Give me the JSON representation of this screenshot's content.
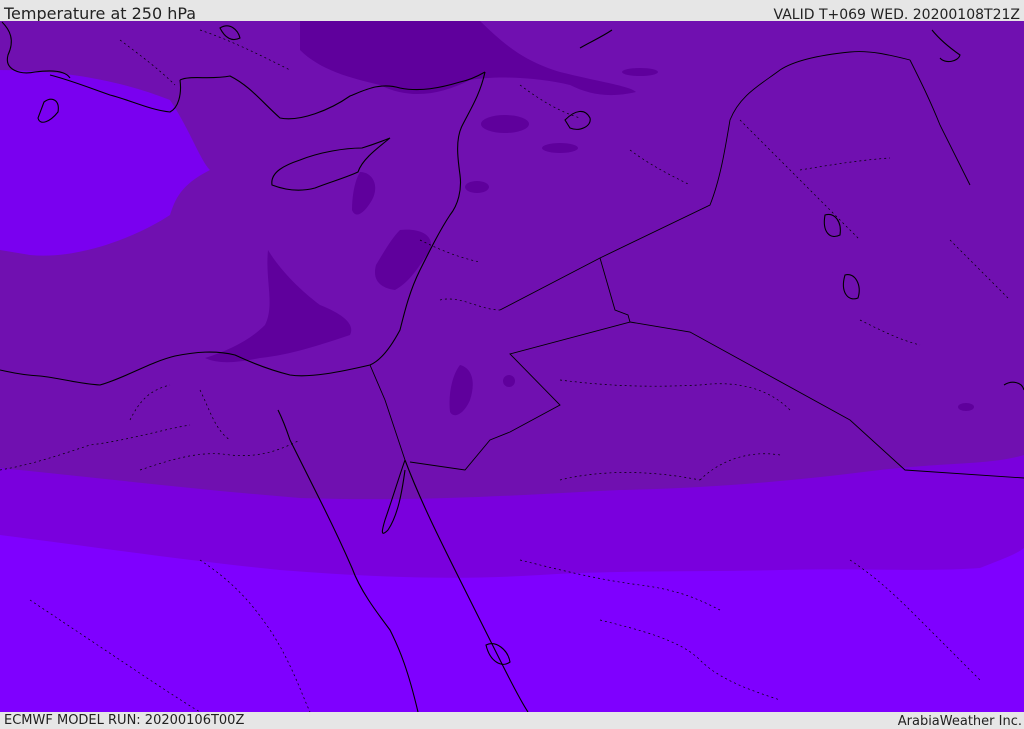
{
  "header": {
    "title": "Temperature at 250 hPa",
    "valid_time": "VALID T+069 WED. 20200108T21Z"
  },
  "footer": {
    "model_run": "ECMWF MODEL RUN: 20200106T00Z",
    "credit": "ArabiaWeather Inc."
  },
  "map": {
    "field": "Temperature at 250 hPa",
    "colors": {
      "coldest": "#5f009c",
      "cold": "#7010b0",
      "mid": "#7a00dd",
      "warm": "#7f00ff",
      "boundary": "#000000"
    }
  }
}
